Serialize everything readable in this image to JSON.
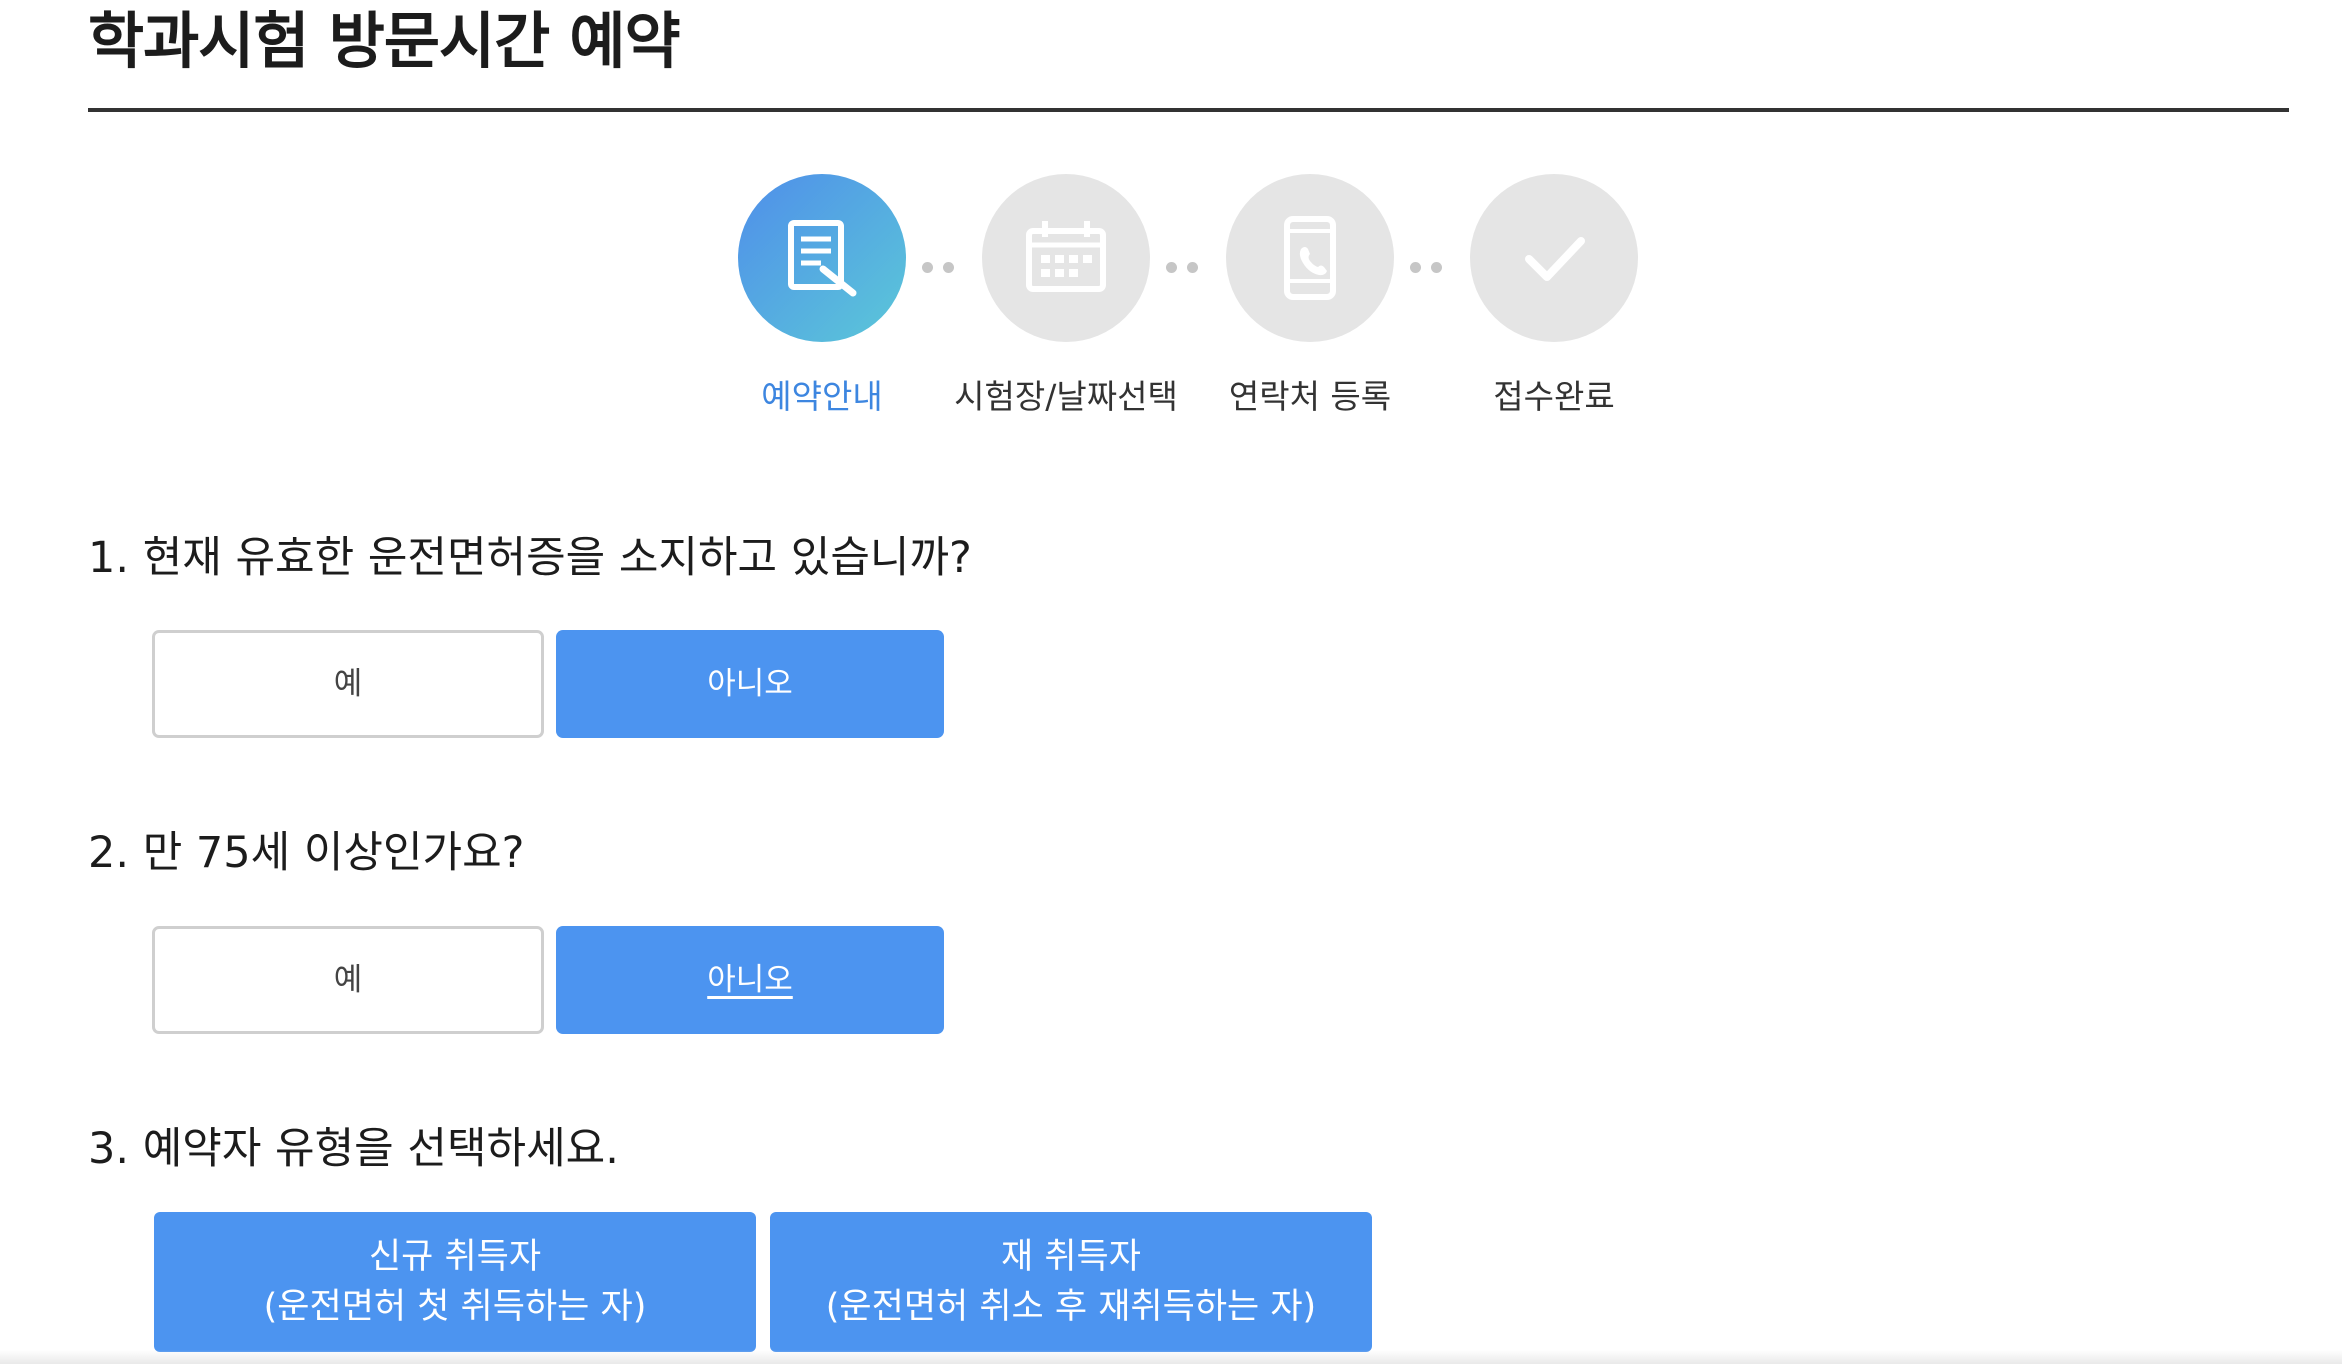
{
  "page": {
    "title": "학과시험 방문시간 예약"
  },
  "stepper": {
    "steps": [
      {
        "label": "예약안내",
        "icon": "document-edit-icon",
        "active": true
      },
      {
        "label": "시험장/날짜선택",
        "icon": "calendar-icon",
        "active": false
      },
      {
        "label": "연락처 등록",
        "icon": "phone-icon",
        "active": false
      },
      {
        "label": "접수완료",
        "icon": "checkmark-icon",
        "active": false
      }
    ]
  },
  "questions": [
    {
      "text": "1. 현재 유효한 운전면허증을 소지하고 있습니까?",
      "options": [
        {
          "label": "예",
          "selected": false
        },
        {
          "label": "아니오",
          "selected": true
        }
      ]
    },
    {
      "text": "2. 만 75세 이상인가요?",
      "options": [
        {
          "label": "예",
          "selected": false
        },
        {
          "label": "아니오",
          "selected": true
        }
      ]
    },
    {
      "text": "3. 예약자 유형을 선택하세요.",
      "options": [
        {
          "title": "신규 취득자",
          "desc": "(운전면허 첫 취득하는 자)"
        },
        {
          "title": "재 취득자",
          "desc": "(운전면허 취소 후 재취득하는 자)"
        }
      ]
    }
  ],
  "colors": {
    "primary": "#4c94f0",
    "active_step_label": "#3d86e0",
    "inactive_step": "#e5e5e5",
    "outline_border": "#cfcfcf"
  }
}
